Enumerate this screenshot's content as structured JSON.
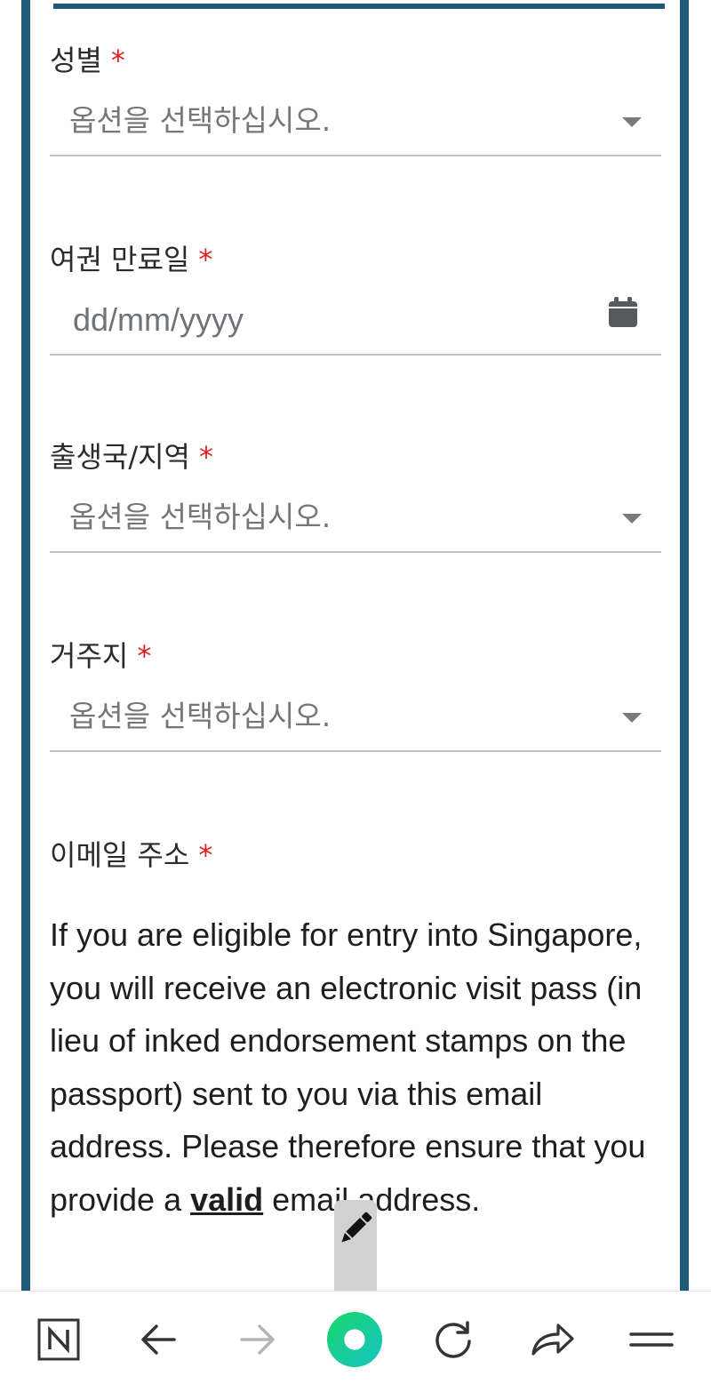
{
  "form": {
    "gender": {
      "label": "성별",
      "required_mark": "*",
      "placeholder": "옵션을 선택하십시오."
    },
    "passport_expiry": {
      "label": "여권 만료일",
      "required_mark": "*",
      "placeholder": "dd/mm/yyyy",
      "icon": "calendar-icon"
    },
    "birth_country": {
      "label": "출생국/지역",
      "required_mark": "*",
      "placeholder": "옵션을 선택하십시오."
    },
    "residence": {
      "label": "거주지",
      "required_mark": "*",
      "placeholder": "옵션을 선택하십시오."
    },
    "email": {
      "label": "이메일 주소",
      "required_mark": "*",
      "info_before": "If you are eligible for entry into Singapore, you will receive an electronic visit pass (in lieu of inked endorsement stamps on the passport) sent to you via this email address. Please therefore ensure that you provide a ",
      "info_bold": "valid",
      "info_after": " email address."
    }
  },
  "overlay": {
    "icon": "pencil-icon"
  },
  "toolbar": {
    "items": [
      {
        "name": "naver-home-button",
        "icon": "n-logo-icon"
      },
      {
        "name": "back-button",
        "icon": "arrow-left-icon"
      },
      {
        "name": "forward-button",
        "icon": "arrow-right-icon"
      },
      {
        "name": "green-dot-button",
        "icon": "green-dot-icon"
      },
      {
        "name": "reload-button",
        "icon": "reload-icon"
      },
      {
        "name": "share-button",
        "icon": "share-icon"
      },
      {
        "name": "menu-button",
        "icon": "menu-icon"
      }
    ]
  },
  "colors": {
    "frame": "#1f5a78",
    "required": "#e02020",
    "accent_green": "#1ed07a"
  }
}
